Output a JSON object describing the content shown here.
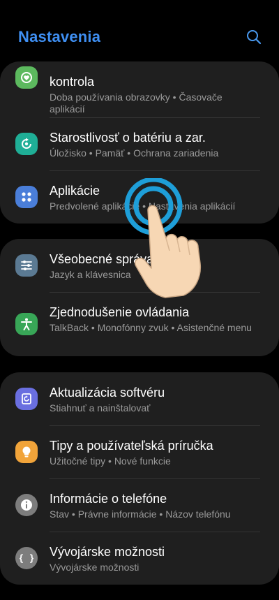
{
  "header": {
    "title": "Nastavenia"
  },
  "groups": [
    {
      "items": [
        {
          "title": "kontrola",
          "subtitle": "Doba používania obrazovky  •  Časovače aplikácií",
          "icon": "digital-wellbeing-icon",
          "color": "#5cb95e"
        },
        {
          "title": "Starostlivosť o batériu a zar.",
          "subtitle": "Úložisko  •  Pamäť  •  Ochrana zariadenia",
          "icon": "device-care-icon",
          "color": "#1fae96"
        },
        {
          "title": "Aplikácie",
          "subtitle": "Predvolené aplikácie  •  Nastavenia aplikácií",
          "icon": "apps-icon",
          "color": "#4a7ed9"
        }
      ]
    },
    {
      "items": [
        {
          "title": "Všeobecné správa",
          "subtitle": "Jazyk a klávesnica",
          "icon": "general-management-icon",
          "color": "#5b7a93"
        },
        {
          "title": "Zjednodušenie ovládania",
          "subtitle": "TalkBack  •  Monofónny zvuk  •  Asistenčné menu",
          "icon": "accessibility-icon",
          "color": "#38a657"
        }
      ]
    },
    {
      "items": [
        {
          "title": "Aktualizácia softvéru",
          "subtitle": "Stiahnuť a nainštalovať",
          "icon": "software-update-icon",
          "color": "#6a6fe0"
        },
        {
          "title": "Tipy a používateľská príručka",
          "subtitle": "Užitočné tipy  •  Nové funkcie",
          "icon": "tips-icon",
          "color": "#f1a43a"
        },
        {
          "title": "Informácie o telefóne",
          "subtitle": "Stav  •  Právne informácie  •  Názov telefónu",
          "icon": "info-icon",
          "color": "#7d7d7d"
        },
        {
          "title": "Vývojárske možnosti",
          "subtitle": "Vývojárske možnosti",
          "icon": "developer-options-icon",
          "color": "#7d7d7d"
        }
      ]
    }
  ],
  "colors": {
    "accent": "#3f8ff2",
    "card": "#1f1f1f",
    "background": "#000000",
    "tap_ring": "#1e9ed8",
    "hand": "#f7d7b4"
  }
}
